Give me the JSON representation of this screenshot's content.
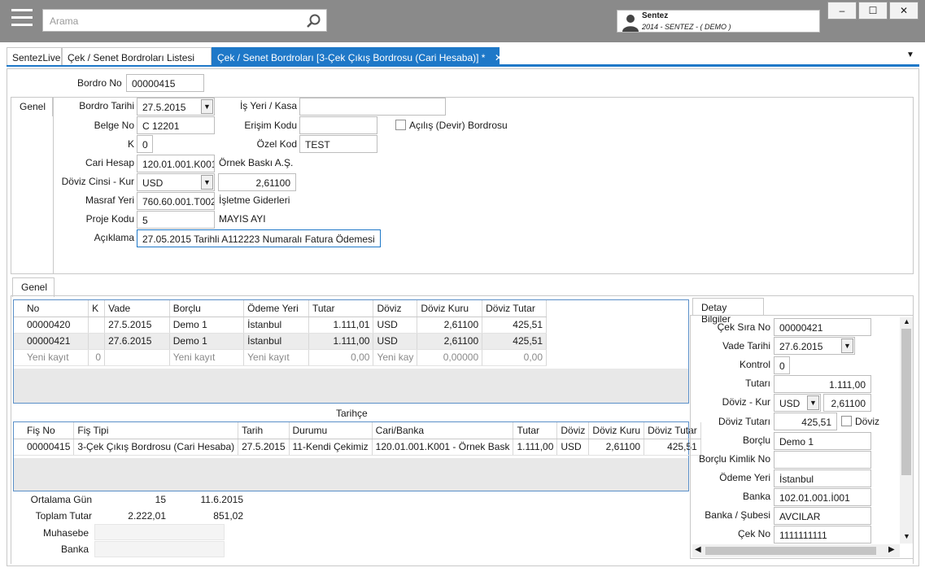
{
  "search": {
    "placeholder": "Arama"
  },
  "user": {
    "name": "Sentez",
    "subtitle": "2014 - SENTEZ - ( DEMO )"
  },
  "window": {
    "minimize": "–",
    "maximize": "☐",
    "close": "✕"
  },
  "tabs": [
    {
      "label": "SentezLive"
    },
    {
      "label": "Çek / Senet Bordroları Listesi"
    },
    {
      "label": "Çek / Senet Bordroları  [3-Çek Çıkış Bordrosu (Cari Hesaba)] *"
    }
  ],
  "tab_close": "✕",
  "tab_menu": "▼",
  "header": {
    "bordro_no_label": "Bordro No",
    "bordro_no": "00000415",
    "genel_tab": "Genel",
    "bordro_tarihi_label": "Bordro Tarihi",
    "bordro_tarihi": "27.5.2015",
    "is_yeri_label": "İş Yeri / Kasa",
    "is_yeri": "",
    "belge_no_label": "Belge No",
    "belge_no": "C 12201",
    "erisim_kodu_label": "Erişim Kodu",
    "erisim_kodu": "",
    "acilis_label": "Açılış (Devir) Bordrosu",
    "k_label": "K",
    "k": "0",
    "ozel_kod_label": "Özel Kod",
    "ozel_kod": "TEST",
    "cari_hesap_label": "Cari Hesap",
    "cari_hesap": "120.01.001.K001",
    "cari_hesap_name": "Örnek Baskı A.Ş.",
    "doviz_label": "Döviz Cinsi - Kur",
    "doviz": "USD",
    "kur": "2,61100",
    "masraf_yeri_label": "Masraf Yeri",
    "masraf_yeri": "760.60.001.T002",
    "masraf_yeri_name": "İşletme Giderleri",
    "proje_kodu_label": "Proje Kodu",
    "proje_kodu": "5",
    "proje_name": "MAYIS AYI",
    "aciklama_label": "Açıklama",
    "aciklama": "27.05.2015 Tarihli A112223 Numaralı Fatura Ödemesi"
  },
  "lower_tab": "Genel",
  "grid": {
    "columns": [
      "No",
      "K",
      "Vade",
      "Borçlu",
      "Ödeme Yeri",
      "Tutar",
      "Döviz",
      "Döviz Kuru",
      "Döviz Tutar"
    ],
    "rows": [
      [
        "00000420",
        "",
        "27.5.2015",
        "Demo 1",
        "İstanbul",
        "1.111,01",
        "USD",
        "2,61100",
        "425,51"
      ],
      [
        "00000421",
        "",
        "27.6.2015",
        "Demo 1",
        "İstanbul",
        "1.111,00",
        "USD",
        "2,61100",
        "425,51"
      ]
    ],
    "new_row": [
      "Yeni kayıt",
      "0",
      "",
      "Yeni kayıt",
      "Yeni kayıt",
      "0,00",
      "Yeni kay",
      "0,00000",
      "0,00"
    ]
  },
  "history": {
    "title": "Tarihçe",
    "columns": [
      "Fiş No",
      "Fiş Tipi",
      "Tarih",
      "Durumu",
      "Cari/Banka",
      "Tutar",
      "Döviz",
      "Döviz Kuru",
      "Döviz Tutar"
    ],
    "rows": [
      [
        "00000415",
        "3-Çek Çıkış Bordrosu (Cari Hesaba)",
        "27.5.2015",
        "11-Kendi Çekimiz",
        "120.01.001.K001 - Örnek Bask",
        "1.111,00",
        "USD",
        "2,61100",
        "425,51"
      ]
    ]
  },
  "summary": {
    "ortalama_gun_label": "Ortalama Gün",
    "ortalama_gun": "15",
    "ortalama_tarih": "11.6.2015",
    "toplam_tutar_label": "Toplam Tutar",
    "toplam_tutar": "2.222,01",
    "toplam_doviz": "851,02",
    "muhasebe_label": "Muhasebe",
    "banka_label": "Banka"
  },
  "detail": {
    "tab": "Detay Bilgiler",
    "cek_sira_no_label": "Çek Sıra No",
    "cek_sira_no": "00000421",
    "vade_tarihi_label": "Vade Tarihi",
    "vade_tarihi": "27.6.2015",
    "kontrol_label": "Kontrol",
    "kontrol": "0",
    "tutari_label": "Tutarı",
    "tutari": "1.111,00",
    "doviz_kur_label": "Döviz - Kur",
    "doviz": "USD",
    "kur": "2,61100",
    "doviz_tutari_label": "Döviz Tutarı",
    "doviz_tutari": "425,51",
    "doviz_chk_label": "Döviz",
    "borclu_label": "Borçlu",
    "borclu": "Demo 1",
    "borclu_kimlik_label": "Borçlu Kimlik No",
    "borclu_kimlik": "",
    "odeme_yeri_label": "Ödeme Yeri",
    "odeme_yeri": "İstanbul",
    "banka_label": "Banka",
    "banka": "102.01.001.İ001",
    "banka_subesi_label": "Banka / Şubesi",
    "banka_subesi": "AVCILAR",
    "cek_no_label": "Çek No",
    "cek_no": "1111111111"
  }
}
